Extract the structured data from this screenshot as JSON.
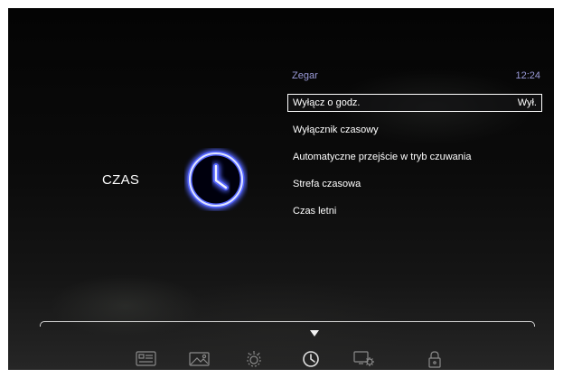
{
  "section": {
    "title": "CZAS",
    "icon": "clock-icon"
  },
  "header": {
    "title": "Zegar",
    "time": "12:24"
  },
  "menu": {
    "items": [
      {
        "label": "Wyłącz o godz.",
        "value": "Wył.",
        "selected": true
      },
      {
        "label": "Wyłącznik czasowy",
        "value": "",
        "selected": false
      },
      {
        "label": "Automatyczne przejście w tryb czuwania",
        "value": "",
        "selected": false
      },
      {
        "label": "Strefa czasowa",
        "value": "",
        "selected": false
      },
      {
        "label": "Czas letni",
        "value": "",
        "selected": false
      }
    ]
  },
  "bottom_nav": {
    "active_index": 3,
    "items": [
      {
        "icon": "channel-list-icon"
      },
      {
        "icon": "picture-icon"
      },
      {
        "icon": "sound-icon"
      },
      {
        "icon": "clock-icon"
      },
      {
        "icon": "settings-icon"
      },
      {
        "icon": "lock-icon"
      }
    ]
  },
  "colors": {
    "accent_glow": "#5566ff",
    "header_text": "#9a9ad8",
    "text": "#ffffff",
    "nav_icon": "#8a8a8a"
  }
}
